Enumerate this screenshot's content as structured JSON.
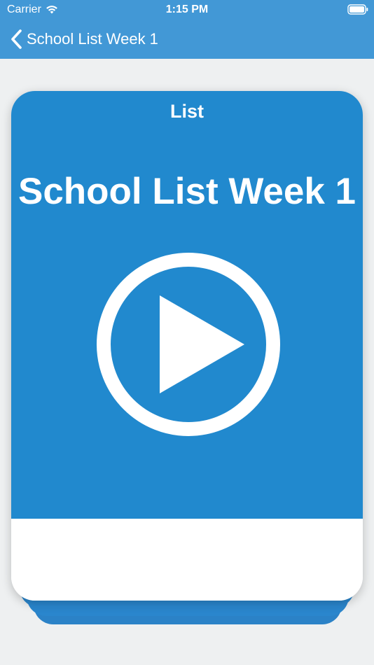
{
  "status_bar": {
    "carrier": "Carrier",
    "time": "1:15 PM"
  },
  "nav": {
    "back_label": "School List Week 1",
    "back_icon": "chevron-left-icon"
  },
  "card": {
    "category": "List",
    "title": "School List Week 1",
    "play_icon": "play-circle-icon"
  },
  "colors": {
    "nav_bar": "#4298D6",
    "card_blue": "#2189CE",
    "background": "#EEF0F1",
    "white": "#FFFFFF"
  }
}
